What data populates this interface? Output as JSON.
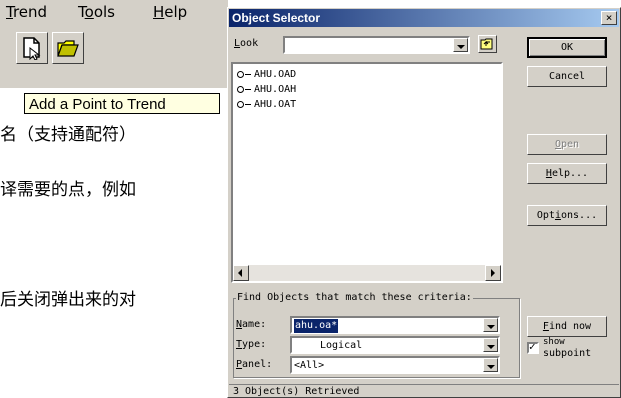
{
  "app": {
    "menu": [
      {
        "label": "Trend",
        "accel": "T",
        "rest": "rend"
      },
      {
        "label": "Tools",
        "accel_pre": "T",
        "accel": "o",
        "rest": "ols"
      },
      {
        "label": "Help",
        "accel": "H",
        "rest": "elp"
      }
    ],
    "tooltip": "Add a Point to Trend",
    "text_lines": [
      "名（支持通配符）",
      "译需要的点，例如",
      "后关闭弹出来的对"
    ]
  },
  "dialog": {
    "title": "Object Selector",
    "close_glyph": "×",
    "look_label": "Look",
    "look_value": "",
    "objects": [
      "AHU.OAD",
      "AHU.OAH",
      "AHU.OAT"
    ],
    "buttons": {
      "ok": "OK",
      "cancel": "Cancel",
      "open": "Open",
      "help": "Help...",
      "options": "Options...",
      "find_now": "Find now"
    },
    "criteria_title": "Find Objects that match these criteria:",
    "name_label": "Name:",
    "name_value": "ahu.oa*",
    "type_label": "Type:",
    "type_value": "Logical",
    "panel_label": "Panel:",
    "panel_value": "<All>",
    "show_subpoint_label_1": "show",
    "show_subpoint_label_2": "subpoint",
    "show_subpoint_checked": true,
    "status": "3 Object(s) Retrieved"
  },
  "colors": {
    "title_active": "#0a246a",
    "face": "#d4d0c8",
    "tooltip_bg": "#ffffe1",
    "selection": "#0a246a"
  }
}
